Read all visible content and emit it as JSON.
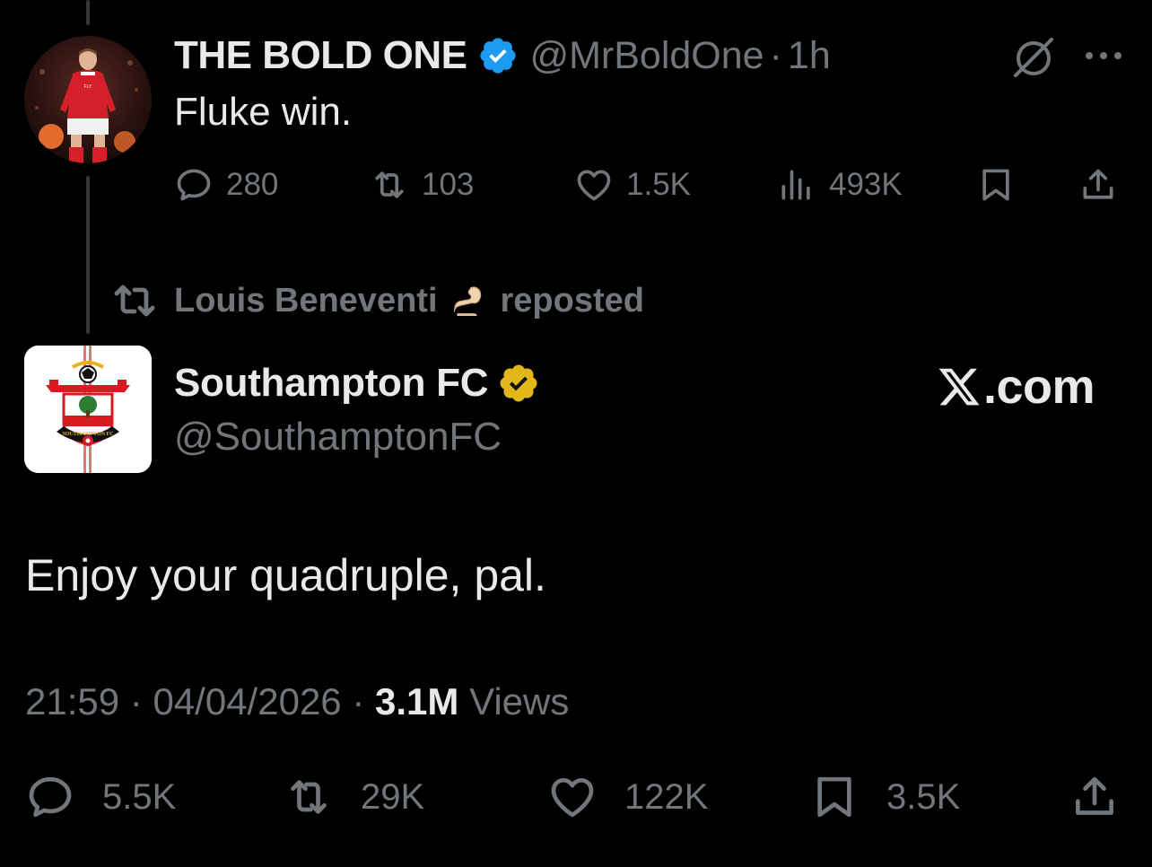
{
  "tweet1": {
    "display_name": "THE BOLD ONE",
    "handle": "@MrBoldOne",
    "separator": "·",
    "time": "1h",
    "text": "Fluke win.",
    "verified_color": "#1d9bf0",
    "actions": {
      "replies": "280",
      "reposts": "103",
      "likes": "1.5K",
      "views": "493K"
    },
    "icons": [
      "reply-icon",
      "repost-icon",
      "like-icon",
      "views-icon",
      "bookmark-icon",
      "share-icon",
      "grok-icon",
      "more-icon"
    ]
  },
  "repost_banner": {
    "name": "Louis Beneventi",
    "suffix": "reposted",
    "emoji": "pinched-fingers-emoji"
  },
  "tweet2": {
    "display_name": "Southampton FC",
    "handle": "@SouthamptonFC",
    "badge_color": "#e2b719",
    "brand_label": ".com",
    "text": "Enjoy your quadruple, pal.",
    "timestamp": "21:59",
    "date": "04/04/2026",
    "separator": "·",
    "views_count": "3.1M",
    "views_label": "Views",
    "actions": {
      "replies": "5.5K",
      "reposts": "29K",
      "likes": "122K",
      "bookmarks": "3.5K"
    }
  },
  "theme": {
    "background": "#000000",
    "text_primary": "#e7e9ea",
    "text_secondary": "#71767b",
    "thread_line": "#333639"
  }
}
